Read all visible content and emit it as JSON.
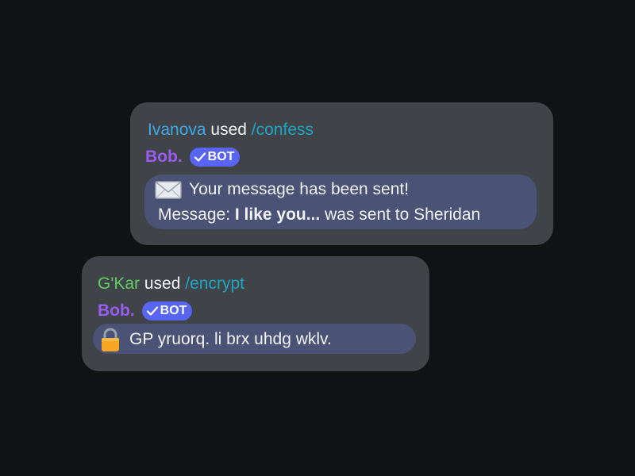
{
  "messages": [
    {
      "user": "Ivanova",
      "used_text": "used",
      "command": "/confess",
      "bot_name": "Bob.",
      "bot_tag": "BOT",
      "icon": "envelope-icon",
      "line1": "Your message has been sent!",
      "line2_prefix": "Message: ",
      "line2_bold": "I like you...",
      "line2_suffix": " was sent to Sheridan"
    },
    {
      "user": "G'Kar",
      "used_text": "used",
      "command": "/encrypt",
      "bot_name": "Bob.",
      "bot_tag": "BOT",
      "icon": "lock-icon",
      "line1": "GP yruorq. li brx uhdg wklv."
    }
  ],
  "colors": {
    "background": "#111214",
    "card": "#404348",
    "embed": "#4a5275",
    "user_blue": "#3fa9e8",
    "user_green": "#5fcf64",
    "command": "#1fa5c4",
    "bot_name": "#9a5cf2",
    "bot_badge": "#5865f2"
  }
}
